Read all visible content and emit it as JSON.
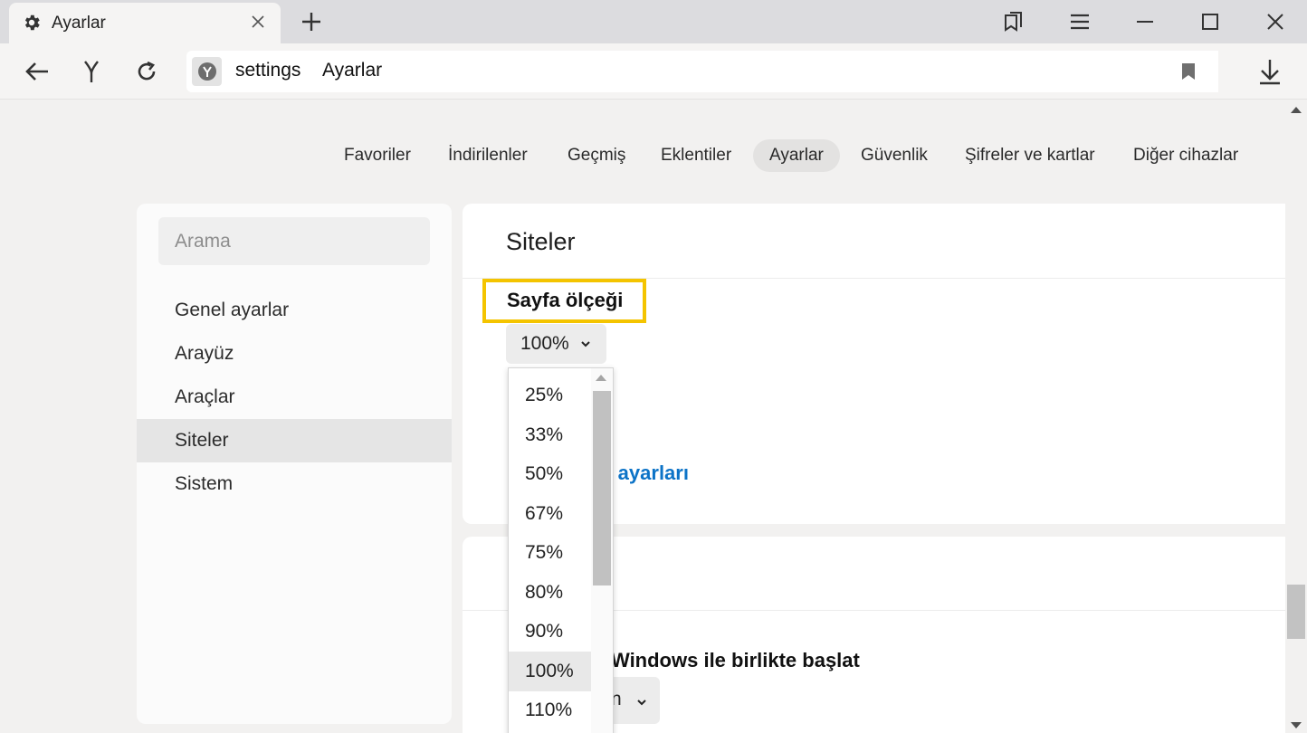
{
  "browser": {
    "tab_title": "Ayarlar",
    "address_host": "settings",
    "address_title": "Ayarlar"
  },
  "topnav": {
    "items": [
      {
        "label": "Favoriler"
      },
      {
        "label": "İndirilenler"
      },
      {
        "label": "Geçmiş"
      },
      {
        "label": "Eklentiler"
      },
      {
        "label": "Ayarlar",
        "active": true
      },
      {
        "label": "Güvenlik"
      },
      {
        "label": "Şifreler ve kartlar"
      },
      {
        "label": "Diğer cihazlar"
      }
    ]
  },
  "sidebar": {
    "search_placeholder": "Arama",
    "items": [
      {
        "label": "Genel ayarlar"
      },
      {
        "label": "Arayüz"
      },
      {
        "label": "Araçlar"
      },
      {
        "label": "Siteler",
        "active": true
      },
      {
        "label": "Sistem"
      }
    ]
  },
  "main": {
    "section_title": "Siteler",
    "page_zoom_label": "Sayfa ölçeği",
    "page_zoom_value": "100%",
    "site_settings_link_visible": "te ayarları",
    "startup_label_visible": "Windows ile birlikte başlat",
    "startup_select_visible": "n"
  },
  "zoom_dropdown": {
    "options": [
      "25%",
      "33%",
      "50%",
      "67%",
      "75%",
      "80%",
      "90%",
      "100%",
      "110%"
    ],
    "selected": "100%"
  },
  "colors": {
    "accent_link": "#0c73c7",
    "highlight_border": "#f4c400"
  }
}
